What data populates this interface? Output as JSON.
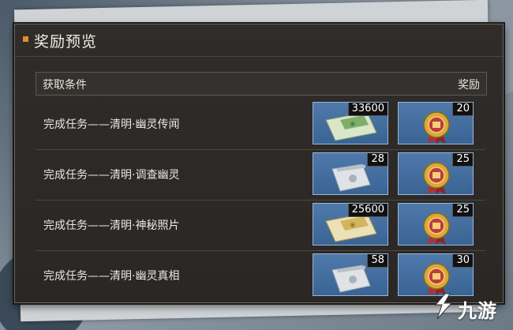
{
  "panel": {
    "title": "奖励预览"
  },
  "table": {
    "col_condition": "获取条件",
    "col_reward": "奖励",
    "rows": [
      {
        "condition": "完成任务——清明·幽灵传闻",
        "item1_icon": "green-envelope-icon",
        "item1_count": "33600",
        "item2_icon": "medal-icon",
        "item2_count": "20"
      },
      {
        "condition": "完成任务——清明·调查幽灵",
        "item1_icon": "silver-packet-icon",
        "item1_count": "28",
        "item2_icon": "medal-icon",
        "item2_count": "25"
      },
      {
        "condition": "完成任务——清明·神秘照片",
        "item1_icon": "gold-envelope-icon",
        "item1_count": "25600",
        "item2_icon": "medal-icon",
        "item2_count": "25"
      },
      {
        "condition": "完成任务——清明·幽灵真相",
        "item1_icon": "silver-packet-icon",
        "item1_count": "58",
        "item2_icon": "medal-icon",
        "item2_count": "30"
      }
    ]
  },
  "watermark": {
    "text": "九游"
  },
  "colors": {
    "accent": "#e58a2e",
    "slot_bg": "#4a74a5",
    "panel_bg": "#2d2a27"
  }
}
